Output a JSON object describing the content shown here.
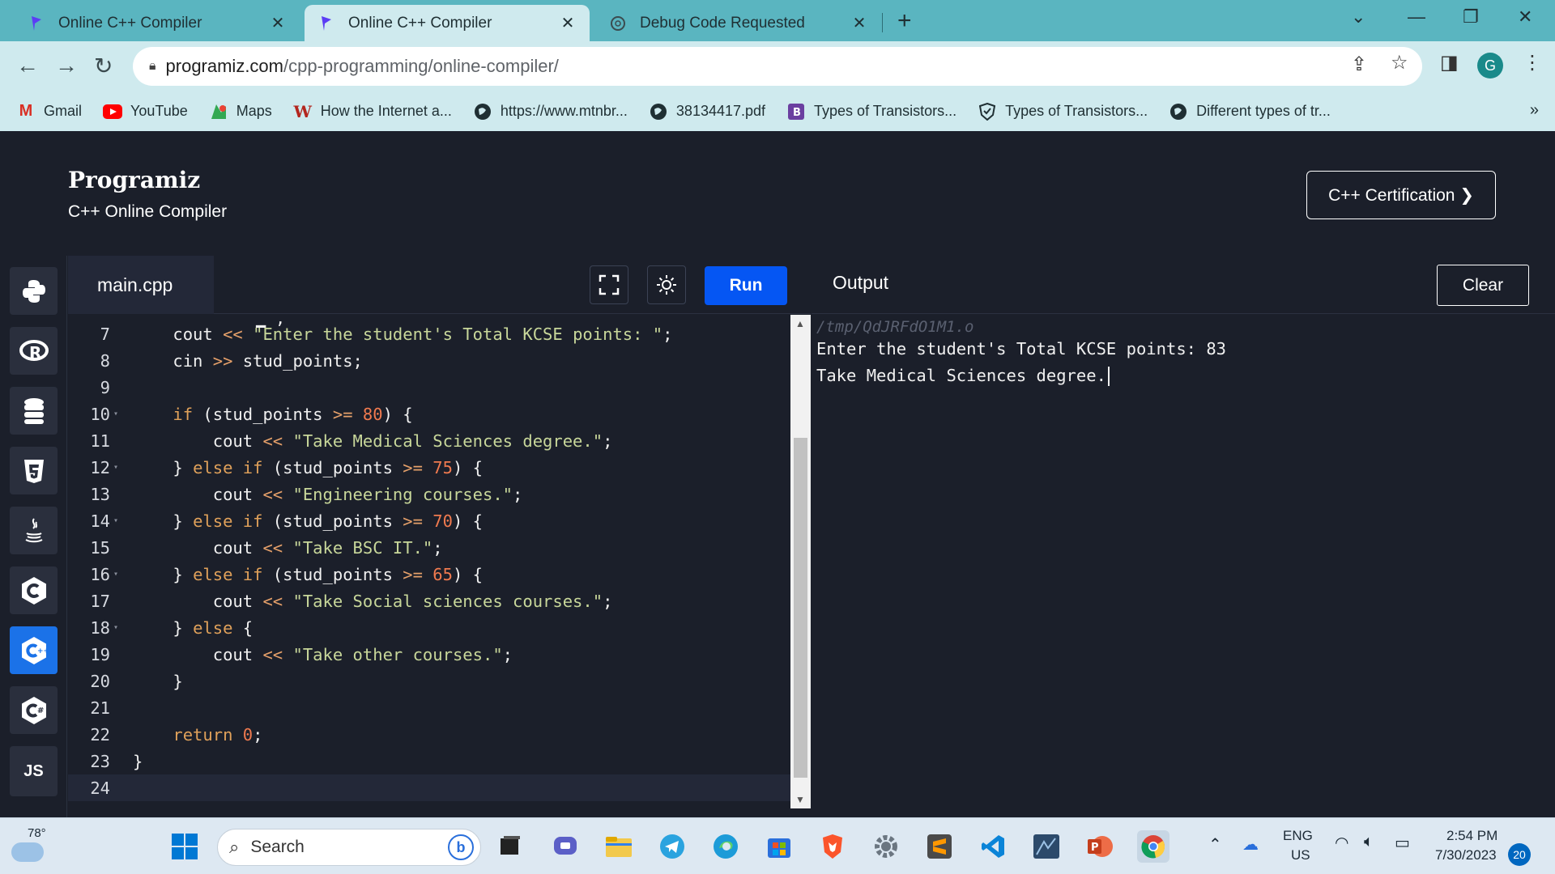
{
  "browser": {
    "tabs": [
      {
        "title": "Online C++ Compiler",
        "active": false
      },
      {
        "title": "Online C++ Compiler",
        "active": true
      },
      {
        "title": "Debug Code Requested",
        "active": false
      }
    ],
    "url_host": "programiz.com",
    "url_path": "/cpp-programming/online-compiler/",
    "profile_initial": "G",
    "bookmarks": [
      {
        "label": "Gmail",
        "icon": "gmail-icon"
      },
      {
        "label": "YouTube",
        "icon": "youtube-icon"
      },
      {
        "label": "Maps",
        "icon": "maps-icon"
      },
      {
        "label": "How the Internet a...",
        "icon": "w-icon"
      },
      {
        "label": "https://www.mtnbr...",
        "icon": "globe-icon"
      },
      {
        "label": "38134417.pdf",
        "icon": "globe-icon"
      },
      {
        "label": "Types of Transistors...",
        "icon": "b-icon"
      },
      {
        "label": "Types of Transistors...",
        "icon": "shield-icon"
      },
      {
        "label": "Different types of tr...",
        "icon": "globe-icon"
      }
    ]
  },
  "site": {
    "logo": "Programiz",
    "subtitle": "C++ Online Compiler",
    "cert_button": "C++ Certification ❯"
  },
  "languages": [
    "python-icon",
    "r-icon",
    "sql-icon",
    "html-icon",
    "java-icon",
    "c-icon",
    "cpp-icon",
    "csharp-icon",
    "js-icon"
  ],
  "languages_js_label": "JS",
  "editor": {
    "filename": "main.cpp",
    "run_label": "Run",
    "lines": [
      {
        "n": "7",
        "fold": "",
        "html": "    cout <span class='op'>&lt;&lt;</span> <span class='str'>\"Enter the student's Total KCSE points: \"</span>;"
      },
      {
        "n": "8",
        "fold": "",
        "html": "    cin <span class='op'>&gt;&gt;</span> stud_points;"
      },
      {
        "n": "9",
        "fold": "",
        "html": ""
      },
      {
        "n": "10",
        "fold": "▾",
        "html": "    <span class='kw'>if</span> (stud_points <span class='op'>&gt;=</span> <span class='num'>80</span>) {"
      },
      {
        "n": "11",
        "fold": "",
        "html": "        cout <span class='op'>&lt;&lt;</span> <span class='str'>\"Take Medical Sciences degree.\"</span>;"
      },
      {
        "n": "12",
        "fold": "▾",
        "html": "    } <span class='kw'>else</span> <span class='kw'>if</span> (stud_points <span class='op'>&gt;=</span> <span class='num'>75</span>) {"
      },
      {
        "n": "13",
        "fold": "",
        "html": "        cout <span class='op'>&lt;&lt;</span> <span class='str'>\"Engineering courses.\"</span>;"
      },
      {
        "n": "14",
        "fold": "▾",
        "html": "    } <span class='kw'>else</span> <span class='kw'>if</span> (stud_points <span class='op'>&gt;=</span> <span class='num'>70</span>) {"
      },
      {
        "n": "15",
        "fold": "",
        "html": "        cout <span class='op'>&lt;&lt;</span> <span class='str'>\"Take BSC IT.\"</span>;"
      },
      {
        "n": "16",
        "fold": "▾",
        "html": "    } <span class='kw'>else</span> <span class='kw'>if</span> (stud_points <span class='op'>&gt;=</span> <span class='num'>65</span>) {"
      },
      {
        "n": "17",
        "fold": "",
        "html": "        cout <span class='op'>&lt;&lt;</span> <span class='str'>\"Take Social sciences courses.\"</span>;"
      },
      {
        "n": "18",
        "fold": "▾",
        "html": "    } <span class='kw'>else</span> {"
      },
      {
        "n": "19",
        "fold": "",
        "html": "        cout <span class='op'>&lt;&lt;</span> <span class='str'>\"Take other courses.\"</span>;"
      },
      {
        "n": "20",
        "fold": "",
        "html": "    }"
      },
      {
        "n": "21",
        "fold": "",
        "html": ""
      },
      {
        "n": "22",
        "fold": "",
        "html": "    <span class='kw'>return</span> <span class='num'>0</span>;"
      },
      {
        "n": "23",
        "fold": "",
        "html": "}"
      },
      {
        "n": "24",
        "fold": "",
        "html": ""
      }
    ]
  },
  "output": {
    "title": "Output",
    "clear_label": "Clear",
    "path": "/tmp/QdJRFdO1M1.o",
    "lines": [
      "Enter the student's Total KCSE points: 83",
      "Take Medical Sciences degree."
    ]
  },
  "taskbar": {
    "temperature": "78°",
    "search_placeholder": "Search",
    "lang_top": "ENG",
    "lang_bottom": "US",
    "time": "2:54 PM",
    "date": "7/30/2023",
    "notifications": "20"
  }
}
